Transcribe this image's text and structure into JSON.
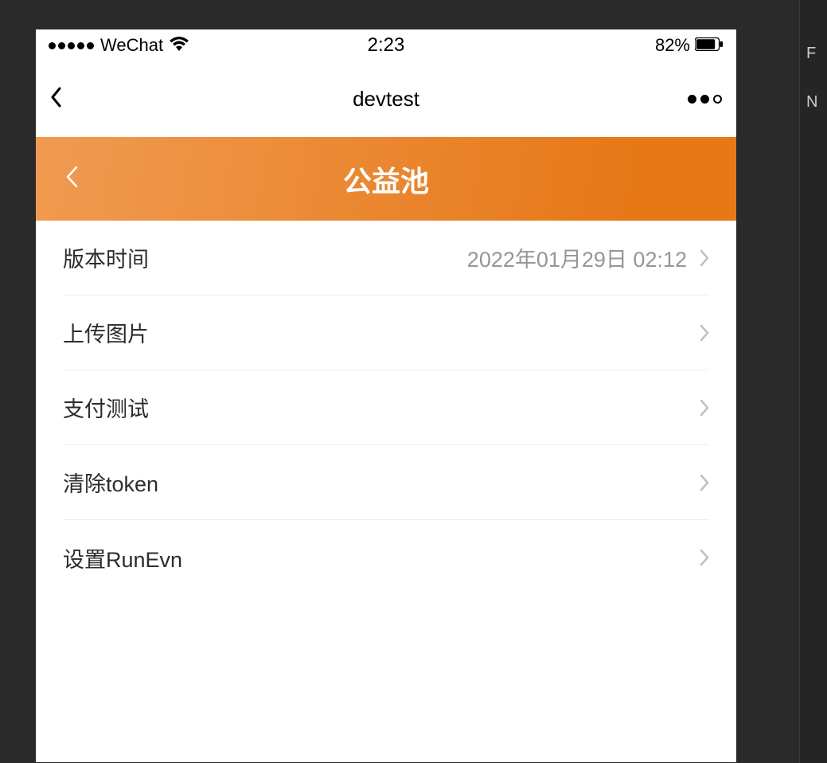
{
  "statusBar": {
    "carrier": "WeChat",
    "time": "2:23",
    "battery": "82%"
  },
  "nav": {
    "title": "devtest"
  },
  "header": {
    "title": "公益池"
  },
  "list": {
    "items": [
      {
        "label": "版本时间",
        "value": "2022年01月29日 02:12"
      },
      {
        "label": "上传图片",
        "value": ""
      },
      {
        "label": "支付测试",
        "value": ""
      },
      {
        "label": "清除token",
        "value": ""
      },
      {
        "label": "设置RunEvn",
        "value": ""
      }
    ]
  },
  "editorSide": {
    "char0": "F",
    "char1": "N"
  }
}
